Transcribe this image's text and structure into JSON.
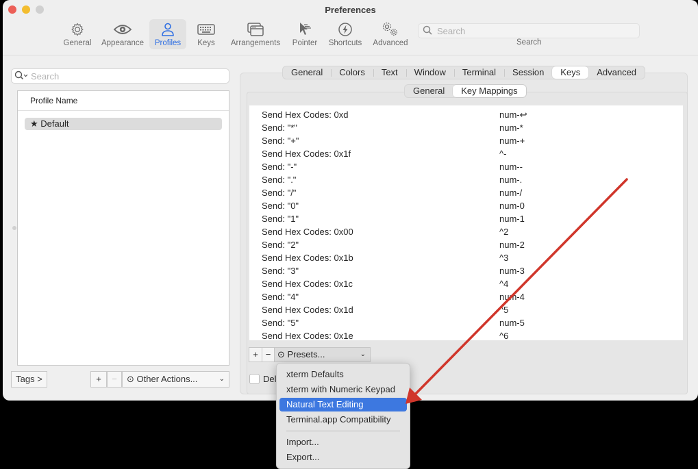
{
  "window": {
    "title": "Preferences"
  },
  "toolbar": {
    "items": [
      {
        "label": "General",
        "icon": "gear-icon"
      },
      {
        "label": "Appearance",
        "icon": "eye-icon"
      },
      {
        "label": "Profiles",
        "icon": "person-icon",
        "active": true
      },
      {
        "label": "Keys",
        "icon": "keyboard-icon"
      },
      {
        "label": "Arrangements",
        "icon": "windows-icon"
      },
      {
        "label": "Pointer",
        "icon": "pointer-icon"
      },
      {
        "label": "Shortcuts",
        "icon": "bolt-icon"
      },
      {
        "label": "Advanced",
        "icon": "gears-icon"
      }
    ],
    "search_placeholder": "Search",
    "search_label": "Search",
    "active_color": "#2f6fe3"
  },
  "profiles": {
    "search_placeholder": "Search",
    "column_header": "Profile Name",
    "rows": [
      {
        "name": "Default",
        "default_marker": "★"
      }
    ],
    "tags_button": "Tags >",
    "add_button": "+",
    "remove_button": "−",
    "other_actions": "Other Actions..."
  },
  "tabs": {
    "main": [
      "General",
      "Colors",
      "Text",
      "Window",
      "Terminal",
      "Session",
      "Keys",
      "Advanced"
    ],
    "main_selected": "Keys",
    "sub": [
      "General",
      "Key Mappings"
    ],
    "sub_selected": "Key Mappings"
  },
  "key_mappings": [
    {
      "action": "Send Hex Codes: 0xd",
      "key": "num-↩"
    },
    {
      "action": "Send: \"*\"",
      "key": "num-*"
    },
    {
      "action": "Send: \"+\"",
      "key": "num-+"
    },
    {
      "action": "Send Hex Codes: 0x1f",
      "key": "^-"
    },
    {
      "action": "Send: \"-\"",
      "key": "num--"
    },
    {
      "action": "Send: \".\"",
      "key": "num-."
    },
    {
      "action": "Send: \"/\"",
      "key": "num-/"
    },
    {
      "action": "Send: \"0\"",
      "key": "num-0"
    },
    {
      "action": "Send: \"1\"",
      "key": "num-1"
    },
    {
      "action": "Send Hex Codes: 0x00",
      "key": "^2"
    },
    {
      "action": "Send: \"2\"",
      "key": "num-2"
    },
    {
      "action": "Send Hex Codes: 0x1b",
      "key": "^3"
    },
    {
      "action": "Send: \"3\"",
      "key": "num-3"
    },
    {
      "action": "Send Hex Codes: 0x1c",
      "key": "^4"
    },
    {
      "action": "Send: \"4\"",
      "key": "num-4"
    },
    {
      "action": "Send Hex Codes: 0x1d",
      "key": "^5"
    },
    {
      "action": "Send: \"5\"",
      "key": "num-5"
    },
    {
      "action": "Send Hex Codes: 0x1e",
      "key": "^6"
    }
  ],
  "mapping_controls": {
    "add": "+",
    "remove": "−",
    "presets": "Presets...",
    "delete_checkbox_label": "Del"
  },
  "presets_menu": {
    "items": [
      "xterm Defaults",
      "xterm with Numeric Keypad",
      "Natural Text Editing",
      "Terminal.app Compatibility"
    ],
    "highlighted": "Natural Text Editing",
    "extra_items": [
      "Import...",
      "Export..."
    ],
    "highlight_color": "#3d78e0"
  },
  "annotation": {
    "arrow_color": "#d0362b"
  }
}
